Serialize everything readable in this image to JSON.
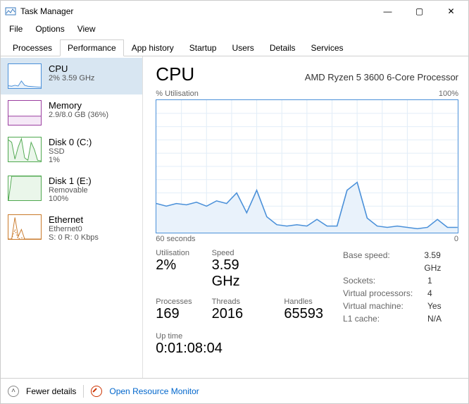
{
  "window": {
    "title": "Task Manager"
  },
  "menu": {
    "file": "File",
    "options": "Options",
    "view": "View"
  },
  "window_controls": {
    "min": "—",
    "max": "▢",
    "close": "✕"
  },
  "tabs": {
    "items": [
      {
        "label": "Processes"
      },
      {
        "label": "Performance"
      },
      {
        "label": "App history"
      },
      {
        "label": "Startup"
      },
      {
        "label": "Users"
      },
      {
        "label": "Details"
      },
      {
        "label": "Services"
      }
    ],
    "active_index": 1
  },
  "sidebar": {
    "items": [
      {
        "title": "CPU",
        "line2": "2%  3.59 GHz",
        "line3": "",
        "color": "#4a90d9"
      },
      {
        "title": "Memory",
        "line2": "2.9/8.0 GB (36%)",
        "line3": "",
        "color": "#9b3fa0"
      },
      {
        "title": "Disk 0 (C:)",
        "line2": "SSD",
        "line3": "1%",
        "color": "#4fa84f"
      },
      {
        "title": "Disk 1 (E:)",
        "line2": "Removable",
        "line3": "100%",
        "color": "#4fa84f"
      },
      {
        "title": "Ethernet",
        "line2": "Ethernet0",
        "line3": "S: 0  R: 0 Kbps",
        "color": "#c97a2b"
      }
    ],
    "selected_index": 0
  },
  "detail": {
    "title": "CPU",
    "subtitle": "AMD Ryzen 5 3600 6-Core Processor",
    "chart_top_left": "% Utilisation",
    "chart_top_right": "100%",
    "chart_bot_left": "60 seconds",
    "chart_bot_right": "0",
    "stats": {
      "utilisation_label": "Utilisation",
      "utilisation_value": "2%",
      "speed_label": "Speed",
      "speed_value": "3.59 GHz",
      "processes_label": "Processes",
      "processes_value": "169",
      "threads_label": "Threads",
      "threads_value": "2016",
      "handles_label": "Handles",
      "handles_value": "65593",
      "uptime_label": "Up time",
      "uptime_value": "0:01:08:04"
    },
    "right": {
      "base_speed_k": "Base speed:",
      "base_speed_v": "3.59 GHz",
      "sockets_k": "Sockets:",
      "sockets_v": "1",
      "vproc_k": "Virtual processors:",
      "vproc_v": "4",
      "vm_k": "Virtual machine:",
      "vm_v": "Yes",
      "l1_k": "L1 cache:",
      "l1_v": "N/A"
    }
  },
  "footer": {
    "fewer": "Fewer details",
    "resmon": "Open Resource Monitor"
  },
  "chart_data": {
    "type": "line",
    "title": "% Utilisation",
    "xlabel": "seconds",
    "ylabel": "% Utilisation",
    "xlim": [
      60,
      0
    ],
    "ylim": [
      0,
      100
    ],
    "x_seconds_ago": [
      60,
      58,
      56,
      54,
      52,
      50,
      48,
      46,
      44,
      42,
      40,
      38,
      36,
      34,
      32,
      30,
      28,
      26,
      24,
      22,
      20,
      18,
      16,
      14,
      12,
      10,
      8,
      6,
      4,
      2,
      0
    ],
    "values_pct": [
      22,
      20,
      22,
      21,
      23,
      20,
      24,
      22,
      30,
      15,
      32,
      12,
      6,
      5,
      6,
      5,
      10,
      5,
      5,
      32,
      38,
      11,
      5,
      4,
      5,
      4,
      3,
      4,
      10,
      4,
      4
    ]
  },
  "sidebar_charts": {
    "cpu": {
      "values_pct": [
        10,
        8,
        12,
        9,
        30,
        12,
        8,
        7,
        6,
        5,
        4
      ]
    },
    "memory": {
      "values_pct": [
        36,
        36,
        36,
        36,
        36,
        36,
        36,
        36,
        36,
        36,
        36
      ]
    },
    "disk0": {
      "values_pct": [
        90,
        80,
        10,
        60,
        95,
        15,
        5,
        80,
        50,
        5,
        3
      ]
    },
    "disk1": {
      "values_pct": [
        0,
        100,
        100,
        100,
        100,
        100,
        100,
        100,
        100,
        100,
        100
      ]
    },
    "eth": {
      "send_pct": [
        0,
        0,
        40,
        0,
        5,
        0,
        0,
        0,
        0,
        0,
        0
      ],
      "recv_pct": [
        0,
        0,
        90,
        10,
        40,
        0,
        0,
        0,
        0,
        0,
        0
      ]
    }
  }
}
